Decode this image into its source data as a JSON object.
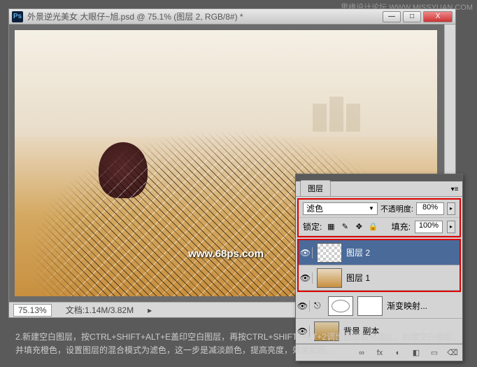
{
  "watermarks": {
    "topright": "思缘设计论坛  WWW.MISSYUAN.COM",
    "canvas": "www.68ps.com"
  },
  "window": {
    "title": "外景逆光美女   大眼仔~旭.psd @ 75.1% (图层 2, RGB/8#) *",
    "buttons": {
      "min": "—",
      "max": "□",
      "close": "X"
    }
  },
  "statusbar": {
    "zoom": "75.13%",
    "docinfo": "文档:1.14M/3.82M"
  },
  "layers": {
    "tab": "图层",
    "blend_mode": "滤色",
    "opacity_label": "不透明度:",
    "opacity_value": "80%",
    "lock_label": "锁定:",
    "fill_label": "填充:",
    "fill_value": "100%",
    "items": [
      {
        "name": "图层 2"
      },
      {
        "name": "图层 1"
      },
      {
        "name": "渐变映射..."
      },
      {
        "name": "背景 副本"
      }
    ],
    "footer_icons": [
      "∞",
      "fx",
      "◐",
      "◧",
      "▭",
      "⌫"
    ]
  },
  "caption": "2.新建空白图层，按CTRL+SHIFT+ALT+E盖印空白图层，再按CTRL+SHIFT+ALT+2调出图层高光选区，新建空白图层，并填充橙色，设置图层的混合模式为滤色，这一步是减淡颜色，提高亮度，效果如图。"
}
